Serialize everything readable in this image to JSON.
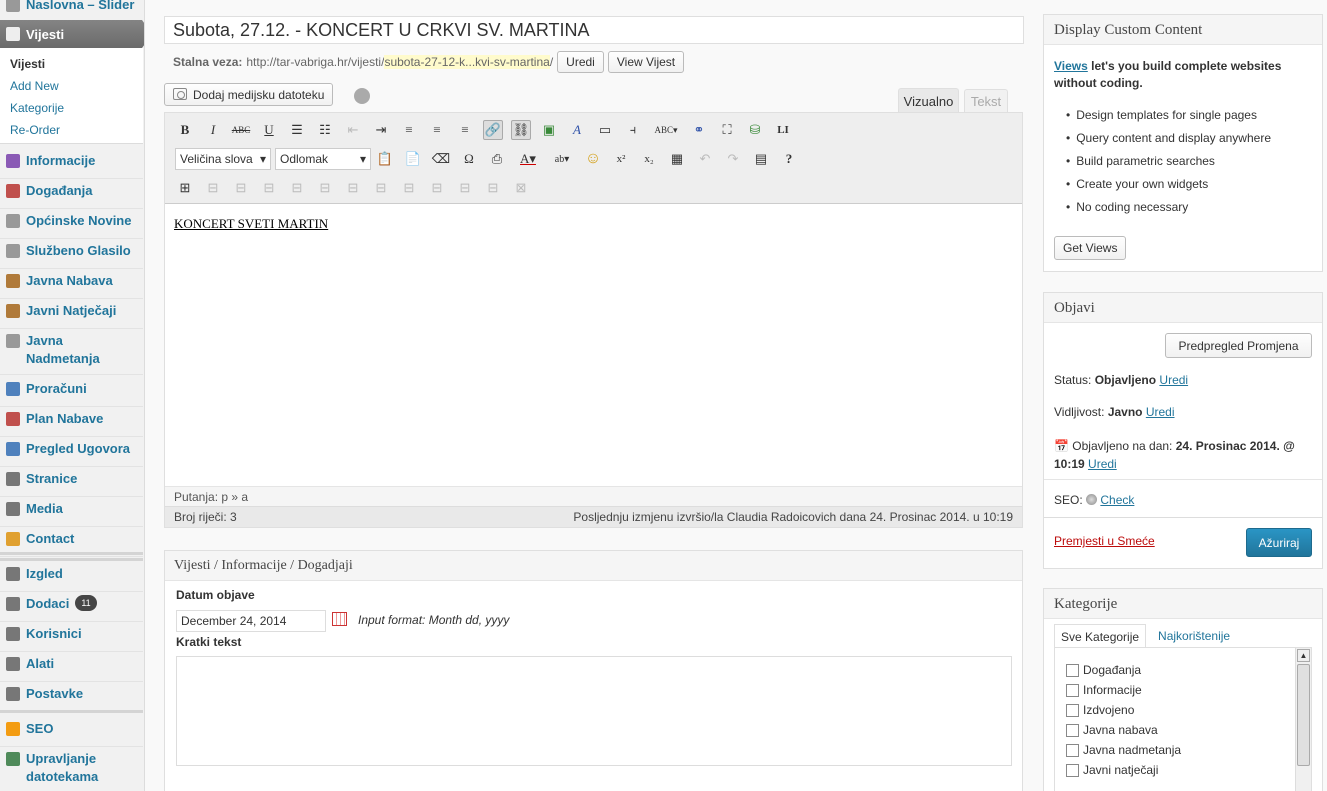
{
  "menu": {
    "top_partial": "Naslovna – Slider",
    "current": "Vijesti",
    "submenu": [
      "Vijesti",
      "Add New",
      "Kategorije",
      "Re-Order"
    ],
    "items": [
      {
        "label": "Informacije",
        "icon": "info-icon",
        "color": "#8a5ab5"
      },
      {
        "label": "Događanja",
        "icon": "events-icon",
        "color": "#c0504d"
      },
      {
        "label": "Općinske Novine",
        "icon": "newspaper-icon",
        "color": "#999999"
      },
      {
        "label": "Službeno Glasilo",
        "icon": "gazette-icon",
        "color": "#999999"
      },
      {
        "label": "Javna Nabava",
        "icon": "gavel-icon",
        "color": "#b07a3a"
      },
      {
        "label": "Javni Natječaji",
        "icon": "gavel-icon",
        "color": "#b07a3a"
      },
      {
        "label": "Javna Nadmetanja",
        "icon": "megaphone-icon",
        "color": "#999999"
      },
      {
        "label": "Proračuni",
        "icon": "chart-icon",
        "color": "#4f81bd"
      },
      {
        "label": "Plan Nabave",
        "icon": "calendar-icon",
        "color": "#c0504d"
      },
      {
        "label": "Pregled Ugovora",
        "icon": "grid-icon",
        "color": "#4f81bd"
      },
      {
        "label": "Stranice",
        "icon": "pages-icon",
        "color": "#777777"
      },
      {
        "label": "Media",
        "icon": "media-icon",
        "color": "#777777"
      },
      {
        "label": "Contact",
        "icon": "contact-icon",
        "color": "#e0a030"
      },
      {
        "label": "Izgled",
        "icon": "appearance-icon",
        "color": "#777777"
      },
      {
        "label": "Dodaci",
        "icon": "plugins-icon",
        "color": "#777777",
        "badge": "11"
      },
      {
        "label": "Korisnici",
        "icon": "users-icon",
        "color": "#777777"
      },
      {
        "label": "Alati",
        "icon": "tools-icon",
        "color": "#777777"
      },
      {
        "label": "Postavke",
        "icon": "settings-icon",
        "color": "#777777"
      },
      {
        "label": "SEO",
        "icon": "seo-icon",
        "color": "#f39c12"
      },
      {
        "label": "Upravljanje datotekama",
        "icon": "files-icon",
        "color": "#4f8a5a"
      }
    ]
  },
  "post": {
    "title": "Subota, 27.12. - KONCERT U CRKVI SV. MARTINA",
    "permalink_label": "Stalna veza:",
    "permalink_base": "http://tar-vabriga.hr/vijesti/",
    "permalink_slug": "subota-27-12-k...kvi-sv-martina",
    "permalink_end": "/",
    "edit_btn": "Uredi",
    "view_btn": "View Vijest"
  },
  "editor": {
    "media_btn": "Dodaj medijsku datoteku",
    "tab_visual": "Vizualno",
    "tab_text": "Tekst",
    "font_size_select": "Veličina slova",
    "format_select": "Odlomak",
    "content": "KONCERT SVETI MARTIN",
    "path": "Putanja: p » a",
    "word_count": "Broj riječi: 3",
    "last_edit": "Posljednju izmjenu izvršio/la Claudia Radoicovich dana 24. Prosinac 2014. u 10:19"
  },
  "metabox": {
    "title": "Vijesti / Informacije / Dogadjaji",
    "date_label": "Datum objave",
    "date_value": "December 24, 2014",
    "date_hint": "Input format: Month dd, yyyy",
    "short_label": "Kratki tekst"
  },
  "dcc": {
    "title": "Display Custom Content",
    "intro_link": "Views",
    "intro_rest": " let's you build complete websites without coding.",
    "features": [
      "Design templates for single pages",
      "Query content and display anywhere",
      "Build parametric searches",
      "Create your own widgets",
      "No coding necessary"
    ],
    "button": "Get Views"
  },
  "publish": {
    "title": "Objavi",
    "preview_btn": "Predpregled Promjena",
    "status_label": "Status:",
    "status_value": "Objavljeno",
    "visibility_label": "Vidljivost:",
    "visibility_value": "Javno",
    "edit": "Uredi",
    "published_label": "Objavljeno na dan:",
    "published_value": "24. Prosinac 2014. @ 10:19",
    "seo_label": "SEO:",
    "seo_check": "Check",
    "trash": "Premjesti u Smeće",
    "update_btn": "Ažuriraj"
  },
  "categories": {
    "title": "Kategorije",
    "tab_all": "Sve Kategorije",
    "tab_popular": "Najkorištenije",
    "items": [
      "Događanja",
      "Informacije",
      "Izdvojeno",
      "Javna nabava",
      "Javna nadmetanja",
      "Javni natječaji"
    ]
  }
}
